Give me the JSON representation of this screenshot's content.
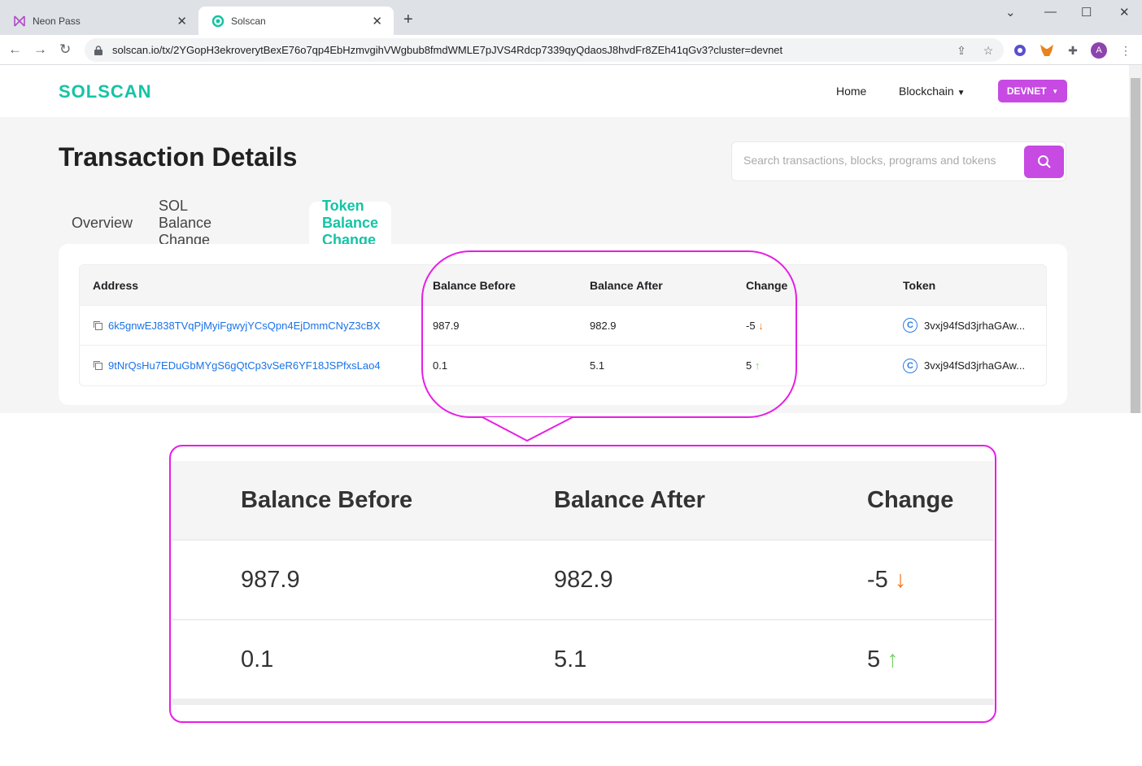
{
  "browser": {
    "tabs": [
      {
        "title": "Neon Pass",
        "active": false
      },
      {
        "title": "Solscan",
        "active": true
      }
    ],
    "url": "solscan.io/tx/2YGopH3ekroverytBexE76o7qp4EbHzmvgihVWgbub8fmdWMLE7pJVS4Rdcp7339qyQdaosJ8hvdFr8ZEh41qGv3?cluster=devnet",
    "profile_initial": "A"
  },
  "header": {
    "logo": "SOLSCAN",
    "nav": {
      "home": "Home",
      "blockchain": "Blockchain"
    },
    "network": "DEVNET"
  },
  "page": {
    "title": "Transaction Details",
    "search_placeholder": "Search transactions, blocks, programs and tokens",
    "tabs": [
      "Overview",
      "SOL Balance Change",
      "Token Balance Change"
    ],
    "active_tab": "Token Balance Change"
  },
  "table": {
    "columns": [
      "Address",
      "Balance Before",
      "Balance After",
      "Change",
      "Token"
    ],
    "rows": [
      {
        "address": "6k5gnwEJ838TVqPjMyiFgwyjYCsQpn4EjDmmCNyZ3cBX",
        "before": "987.9",
        "after": "982.9",
        "change": "-5",
        "direction": "down",
        "token": "3vxj94fSd3jrhaGAw..."
      },
      {
        "address": "9tNrQsHu7EDuGbMYgS6gQtCp3vSeR6YF18JSPfxsLao4",
        "before": "0.1",
        "after": "5.1",
        "change": "5",
        "direction": "up",
        "token": "3vxj94fSd3jrhaGAw..."
      }
    ]
  },
  "zoom": {
    "columns": [
      "Balance Before",
      "Balance After",
      "Change"
    ],
    "rows": [
      {
        "before": "987.9",
        "after": "982.9",
        "change": "-5",
        "direction": "down"
      },
      {
        "before": "0.1",
        "after": "5.1",
        "change": "5",
        "direction": "up"
      }
    ]
  },
  "colors": {
    "brand": "#14c4a4",
    "accent": "#c74ae3",
    "highlight": "#e61ee6",
    "down": "#f5761a",
    "up": "#7ad06b",
    "link": "#1a73e8"
  }
}
